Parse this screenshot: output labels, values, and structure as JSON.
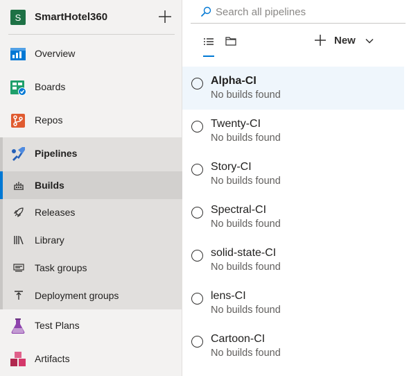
{
  "project": {
    "avatar_letter": "S",
    "name": "SmartHotel360"
  },
  "nav": {
    "overview": "Overview",
    "boards": "Boards",
    "repos": "Repos",
    "pipelines": "Pipelines",
    "sub": {
      "builds": "Builds",
      "releases": "Releases",
      "library": "Library",
      "task_groups": "Task groups",
      "deployment_groups": "Deployment groups"
    },
    "test_plans": "Test Plans",
    "artifacts": "Artifacts"
  },
  "search": {
    "placeholder": "Search all pipelines",
    "value": ""
  },
  "toolbar": {
    "new_label": "New"
  },
  "pipelines": [
    {
      "name": "Alpha-CI",
      "status": "No builds found"
    },
    {
      "name": "Twenty-CI",
      "status": "No builds found"
    },
    {
      "name": "Story-CI",
      "status": "No builds found"
    },
    {
      "name": "Spectral-CI",
      "status": "No builds found"
    },
    {
      "name": "solid-state-CI",
      "status": "No builds found"
    },
    {
      "name": "lens-CI",
      "status": "No builds found"
    },
    {
      "name": "Cartoon-CI",
      "status": "No builds found"
    }
  ],
  "colors": {
    "accent": "#0078d4",
    "project_avatar": "#1e7145",
    "selected_row": "#eff6fc"
  }
}
